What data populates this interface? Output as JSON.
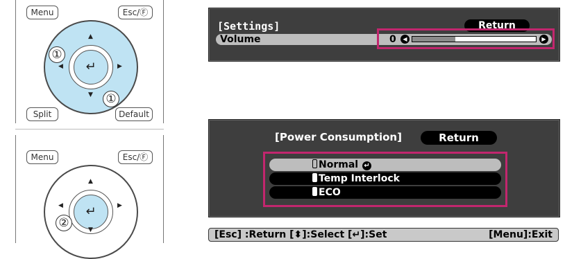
{
  "remote1": {
    "menu_label": "Menu",
    "esc_label": "Esc/Ⓕ",
    "split_label": "Split",
    "default_label": "Default",
    "step_up": "①",
    "step_right": "①"
  },
  "remote2": {
    "menu_label": "Menu",
    "esc_label": "Esc/Ⓕ",
    "step_enter": "②"
  },
  "settings_panel": {
    "title": "[Settings]",
    "return_label": "Return",
    "row_label": "Volume",
    "row_value": "0",
    "slider_level": 0.35
  },
  "power_panel": {
    "title": "[Power Consumption]",
    "return_label": "Return",
    "options": [
      {
        "label": "Normal",
        "selected": true,
        "checked": false,
        "enter_glyph": "↵"
      },
      {
        "label": "Temp Interlock",
        "selected": false,
        "checked": true
      },
      {
        "label": "ECO",
        "selected": false,
        "checked": true
      }
    ]
  },
  "help_bar": {
    "left": "[Esc] :Return  [⬍]:Select  [↵]:Set",
    "right": "[Menu]:Exit"
  },
  "colors": {
    "highlight": "#c2266e",
    "pad_blue": "#bfe3f3",
    "panel_bg": "#3e3e3e"
  }
}
